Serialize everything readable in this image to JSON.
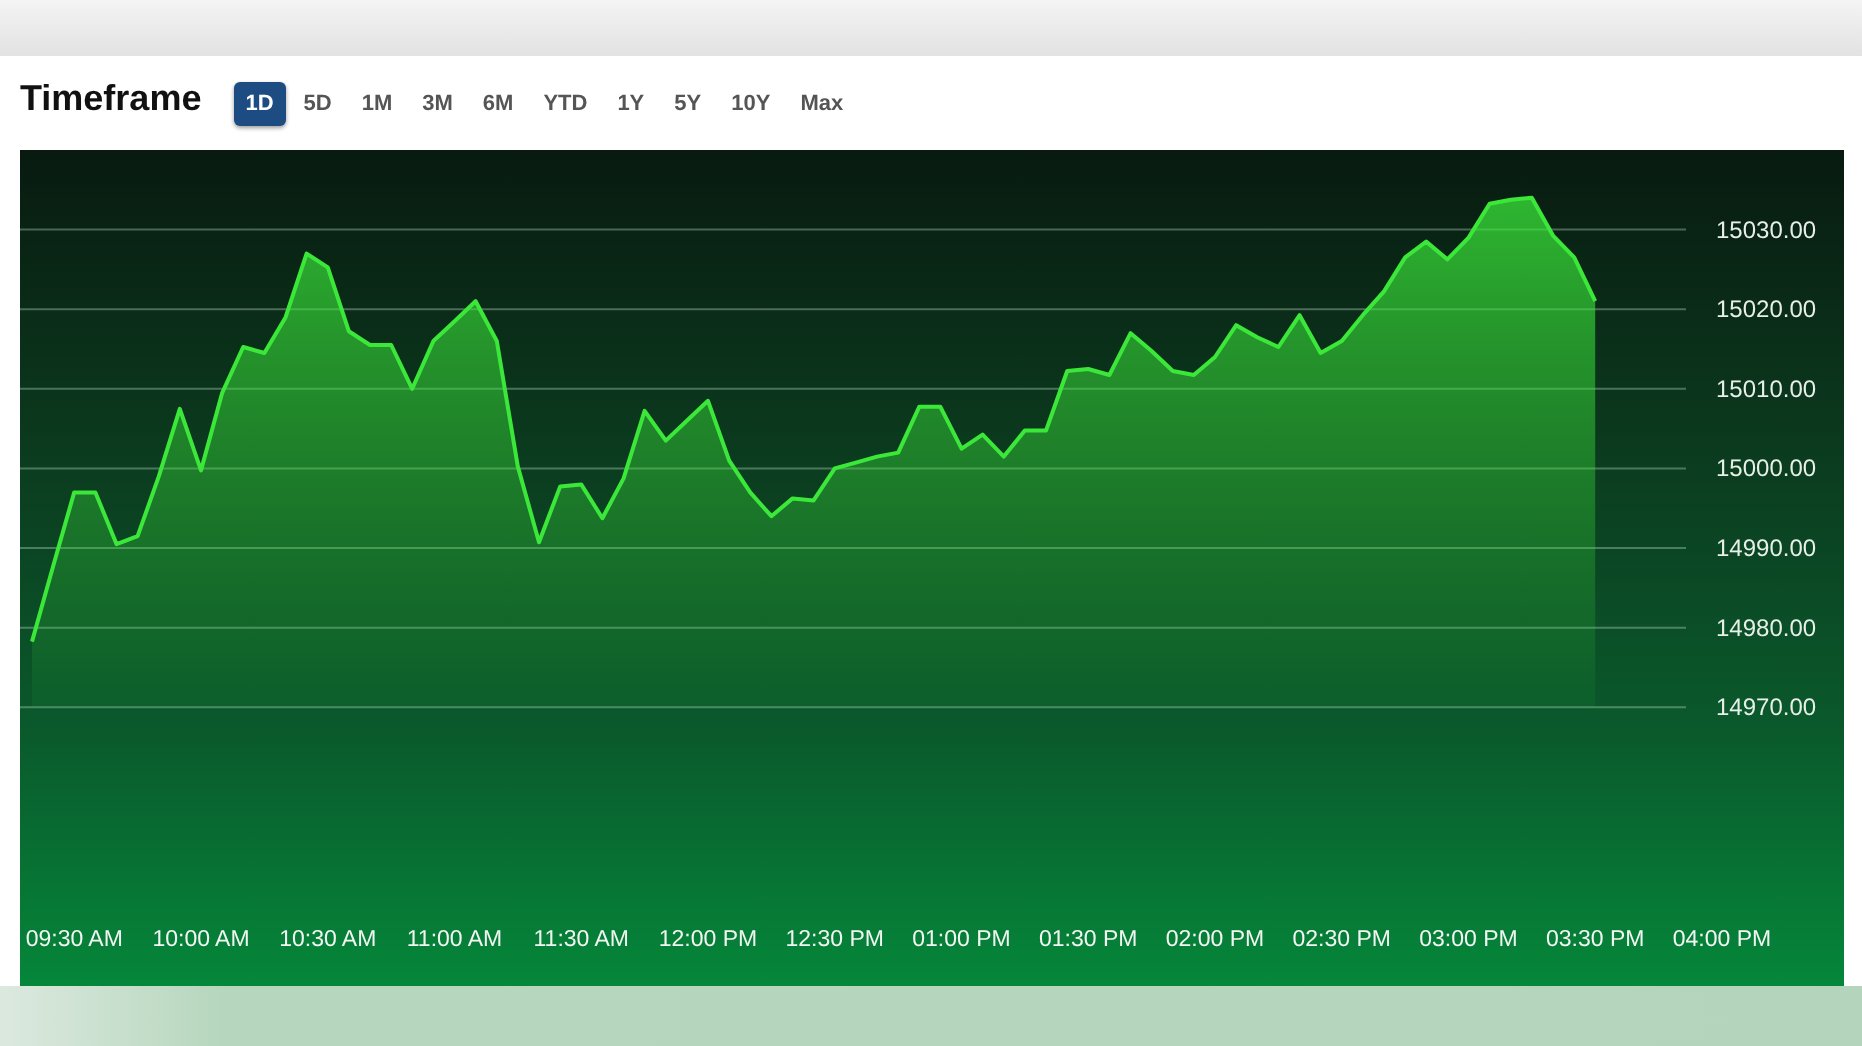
{
  "header": {
    "title": "Timeframe"
  },
  "timeframes": [
    {
      "label": "1D",
      "selected": true
    },
    {
      "label": "5D",
      "selected": false
    },
    {
      "label": "1M",
      "selected": false
    },
    {
      "label": "3M",
      "selected": false
    },
    {
      "label": "6M",
      "selected": false
    },
    {
      "label": "YTD",
      "selected": false
    },
    {
      "label": "1Y",
      "selected": false
    },
    {
      "label": "5Y",
      "selected": false
    },
    {
      "label": "10Y",
      "selected": false
    },
    {
      "label": "Max",
      "selected": false
    }
  ],
  "chart": {
    "chart_data": {
      "type": "area",
      "grid": true,
      "categories": [
        null,
        null,
        "09:30 AM",
        null,
        null,
        null,
        null,
        null,
        "10:00 AM",
        null,
        null,
        null,
        null,
        null,
        "10:30 AM",
        null,
        null,
        null,
        null,
        null,
        "11:00 AM",
        null,
        null,
        null,
        null,
        null,
        "11:30 AM",
        null,
        null,
        null,
        null,
        null,
        "12:00 PM",
        null,
        null,
        null,
        null,
        null,
        "12:30 PM",
        null,
        null,
        null,
        null,
        null,
        "01:00 PM",
        null,
        null,
        null,
        null,
        null,
        "01:30 PM",
        null,
        null,
        null,
        null,
        null,
        "02:00 PM",
        null,
        null,
        null,
        null,
        null,
        "02:30 PM",
        null,
        null,
        null,
        null,
        null,
        "03:00 PM",
        null,
        null,
        null,
        null,
        null,
        "03:30 PM",
        null,
        null,
        null,
        null,
        null,
        "04:00 PM"
      ],
      "series": [
        {
          "color": "#3be83a",
          "values": [
            14978.25,
            14987.75,
            14997,
            14997,
            14990.5,
            14991.5,
            14999,
            15007.5,
            14999.75,
            15009.5,
            15015.25,
            15014.5,
            15019,
            15027,
            15025.25,
            15017.25,
            15015.5,
            15015.5,
            15010,
            15016,
            15018.5,
            15021,
            15016,
            15000.25,
            14990.75,
            14997.75,
            14998,
            14993.75,
            14998.75,
            15007.25,
            15003.5,
            15006,
            15008.5,
            15001,
            14997,
            14994,
            14996.25,
            14996,
            15000,
            15000.75,
            15001.5,
            15002,
            15007.75,
            15007.75,
            15002.5,
            15004.25,
            15001.5,
            15004.75,
            15004.75,
            15012.25,
            15012.5,
            15011.75,
            15017,
            15014.75,
            15012.25,
            15011.75,
            15014,
            15018,
            15016.5,
            15015.25,
            15019.25,
            15014.5,
            15016,
            15019.25,
            15022.25,
            15026.5,
            15028.5,
            15026.25,
            15029,
            15033.25,
            15033.75,
            15034,
            15029.25,
            15026.5,
            15021,
            null,
            null,
            null,
            null,
            null,
            null
          ]
        }
      ],
      "ylim": [
        14935,
        15040
      ],
      "yticks": [
        {
          "value": 15030,
          "label": "15030.00"
        },
        {
          "value": 15020,
          "label": "15020.00"
        },
        {
          "value": 15010,
          "label": "15010.00"
        },
        {
          "value": 15000,
          "label": "15000.00"
        },
        {
          "value": 14990,
          "label": "14990.00"
        },
        {
          "value": 14980,
          "label": "14980.00"
        },
        {
          "value": 14970,
          "label": "14970.00"
        }
      ]
    }
  }
}
